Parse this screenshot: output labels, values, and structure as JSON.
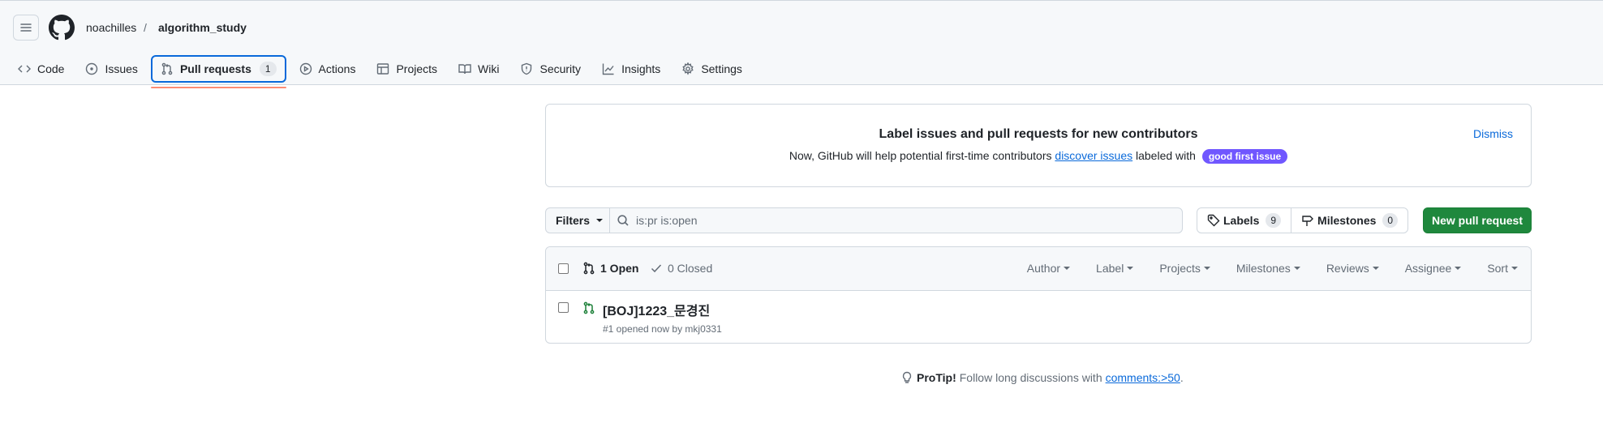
{
  "header": {
    "owner": "noachilles",
    "separator": "/",
    "repo": "algorithm_study"
  },
  "tabs": [
    {
      "label": "Code",
      "icon": "code-icon"
    },
    {
      "label": "Issues",
      "icon": "issue-opened-icon"
    },
    {
      "label": "Pull requests",
      "icon": "git-pull-request-icon",
      "count": "1",
      "active": true
    },
    {
      "label": "Actions",
      "icon": "play-icon"
    },
    {
      "label": "Projects",
      "icon": "table-icon"
    },
    {
      "label": "Wiki",
      "icon": "book-icon"
    },
    {
      "label": "Security",
      "icon": "shield-icon"
    },
    {
      "label": "Insights",
      "icon": "graph-icon"
    },
    {
      "label": "Settings",
      "icon": "gear-icon"
    }
  ],
  "banner": {
    "title": "Label issues and pull requests for new contributors",
    "desc_before": "Now, GitHub will help potential first-time contributors ",
    "desc_link": "discover issues",
    "desc_after": " labeled with",
    "label": "good first issue",
    "dismiss": "Dismiss"
  },
  "toolbar": {
    "filters": "Filters",
    "search_value": "is:pr is:open",
    "labels": "Labels",
    "labels_count": "9",
    "milestones": "Milestones",
    "milestones_count": "0",
    "new_pr": "New pull request"
  },
  "list": {
    "open": "1 Open",
    "closed": "0 Closed",
    "sorts": [
      "Author",
      "Label",
      "Projects",
      "Milestones",
      "Reviews",
      "Assignee",
      "Sort"
    ],
    "items": [
      {
        "title": "[BOJ]1223_문경진",
        "meta": "#1 opened now by mkj0331"
      }
    ]
  },
  "protip": {
    "label": "ProTip!",
    "text": "Follow long discussions with",
    "link": "comments:>50",
    "end": "."
  },
  "colors": {
    "accent": "#0969da",
    "primary_button": "#1f883d",
    "good_first_issue": "#7057ff",
    "active_tab_underline": "#fd8c73"
  }
}
